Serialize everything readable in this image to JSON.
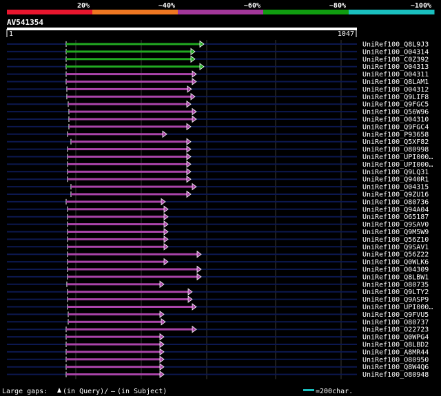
{
  "scale": {
    "labels": [
      "20%",
      "~40%",
      "~60%",
      "~80%",
      "~100%"
    ],
    "colors": [
      "#e8162e",
      "#ee7722",
      "#a2379a",
      "#109c10",
      "#1abfbf"
    ]
  },
  "query": {
    "name": "AV541354",
    "start": "1",
    "end": "1047"
  },
  "legend": {
    "prefix": "Large gaps:",
    "query_text": "(in Query)/",
    "subject_mark": "—",
    "subject_text": "(in Subject)",
    "scale_text": "=200char.",
    "scale_color": "#1abfbf"
  },
  "colors": {
    "green": "#22aa22",
    "purple": "#aa44aa",
    "track": "#0c1850",
    "grid": "#3a3a3a"
  },
  "hits": [
    {
      "label": "UniRef100_Q8L9J3",
      "start": 96,
      "end": 296,
      "color": "green"
    },
    {
      "label": "UniRef100_O04314",
      "start": 96,
      "end": 283,
      "color": "green"
    },
    {
      "label": "UniRef100_C0Z392",
      "start": 96,
      "end": 283,
      "color": "green"
    },
    {
      "label": "UniRef100_O04313",
      "start": 96,
      "end": 296,
      "color": "green"
    },
    {
      "label": "UniRef100_O04311",
      "start": 96,
      "end": 285,
      "color": "purple"
    },
    {
      "label": "UniRef100_Q8LAM1",
      "start": 96,
      "end": 285,
      "color": "purple"
    },
    {
      "label": "UniRef100_O04312",
      "start": 97,
      "end": 278,
      "color": "purple"
    },
    {
      "label": "UniRef100_Q9LIF8",
      "start": 97,
      "end": 283,
      "color": "purple"
    },
    {
      "label": "UniRef100_Q9FGC5",
      "start": 99,
      "end": 277,
      "color": "purple"
    },
    {
      "label": "UniRef100_Q56W96",
      "start": 100,
      "end": 285,
      "color": "purple"
    },
    {
      "label": "UniRef100_O04310",
      "start": 100,
      "end": 285,
      "color": "purple"
    },
    {
      "label": "UniRef100_Q9FGC4",
      "start": 100,
      "end": 277,
      "color": "purple"
    },
    {
      "label": "UniRef100_P93658",
      "start": 98,
      "end": 242,
      "color": "purple"
    },
    {
      "label": "UniRef100_Q5XF82",
      "start": 103,
      "end": 277,
      "color": "purple"
    },
    {
      "label": "UniRef100_O80998",
      "start": 98,
      "end": 277,
      "color": "purple"
    },
    {
      "label": "UniRef100_UPI000…",
      "start": 98,
      "end": 277,
      "color": "purple"
    },
    {
      "label": "UniRef100_UPI000…",
      "start": 98,
      "end": 277,
      "color": "purple"
    },
    {
      "label": "UniRef100_Q9LQ31",
      "start": 98,
      "end": 277,
      "color": "purple"
    },
    {
      "label": "UniRef100_Q940R1",
      "start": 98,
      "end": 277,
      "color": "purple"
    },
    {
      "label": "UniRef100_O04315",
      "start": 103,
      "end": 285,
      "color": "purple"
    },
    {
      "label": "UniRef100_Q9ZU16",
      "start": 103,
      "end": 277,
      "color": "purple"
    },
    {
      "label": "UniRef100_O80736",
      "start": 96,
      "end": 240,
      "color": "purple"
    },
    {
      "label": "UniRef100_Q94A04",
      "start": 98,
      "end": 244,
      "color": "purple"
    },
    {
      "label": "UniRef100_O65187",
      "start": 98,
      "end": 244,
      "color": "purple"
    },
    {
      "label": "UniRef100_Q9SAV0",
      "start": 98,
      "end": 244,
      "color": "purple"
    },
    {
      "label": "UniRef100_Q9M5W9",
      "start": 98,
      "end": 244,
      "color": "purple"
    },
    {
      "label": "UniRef100_Q56Z10",
      "start": 98,
      "end": 244,
      "color": "purple"
    },
    {
      "label": "UniRef100_Q9SAV1",
      "start": 98,
      "end": 244,
      "color": "purple"
    },
    {
      "label": "UniRef100_Q56Z22",
      "start": 98,
      "end": 292,
      "color": "purple"
    },
    {
      "label": "UniRef100_Q0WLK6",
      "start": 98,
      "end": 244,
      "color": "purple"
    },
    {
      "label": "UniRef100_O04309",
      "start": 98,
      "end": 292,
      "color": "purple"
    },
    {
      "label": "UniRef100_Q8LBW1",
      "start": 98,
      "end": 292,
      "color": "purple"
    },
    {
      "label": "UniRef100_O80735",
      "start": 97,
      "end": 238,
      "color": "purple"
    },
    {
      "label": "UniRef100_Q9LTY2",
      "start": 98,
      "end": 279,
      "color": "purple"
    },
    {
      "label": "UniRef100_Q9ASP9",
      "start": 98,
      "end": 279,
      "color": "purple"
    },
    {
      "label": "UniRef100_UPI000…",
      "start": 98,
      "end": 285,
      "color": "purple"
    },
    {
      "label": "UniRef100_Q9FVU5",
      "start": 99,
      "end": 238,
      "color": "purple"
    },
    {
      "label": "UniRef100_O80737",
      "start": 99,
      "end": 240,
      "color": "purple"
    },
    {
      "label": "UniRef100_O22723",
      "start": 96,
      "end": 285,
      "color": "purple"
    },
    {
      "label": "UniRef100_Q0WPG4",
      "start": 96,
      "end": 238,
      "color": "purple"
    },
    {
      "label": "UniRef100_Q8LBD2",
      "start": 96,
      "end": 238,
      "color": "purple"
    },
    {
      "label": "UniRef100_A8MR44",
      "start": 96,
      "end": 238,
      "color": "purple"
    },
    {
      "label": "UniRef100_O80950",
      "start": 96,
      "end": 238,
      "color": "purple"
    },
    {
      "label": "UniRef100_Q8W4Q6",
      "start": 96,
      "end": 238,
      "color": "purple"
    },
    {
      "label": "UniRef100_O80948",
      "start": 96,
      "end": 238,
      "color": "purple"
    }
  ]
}
